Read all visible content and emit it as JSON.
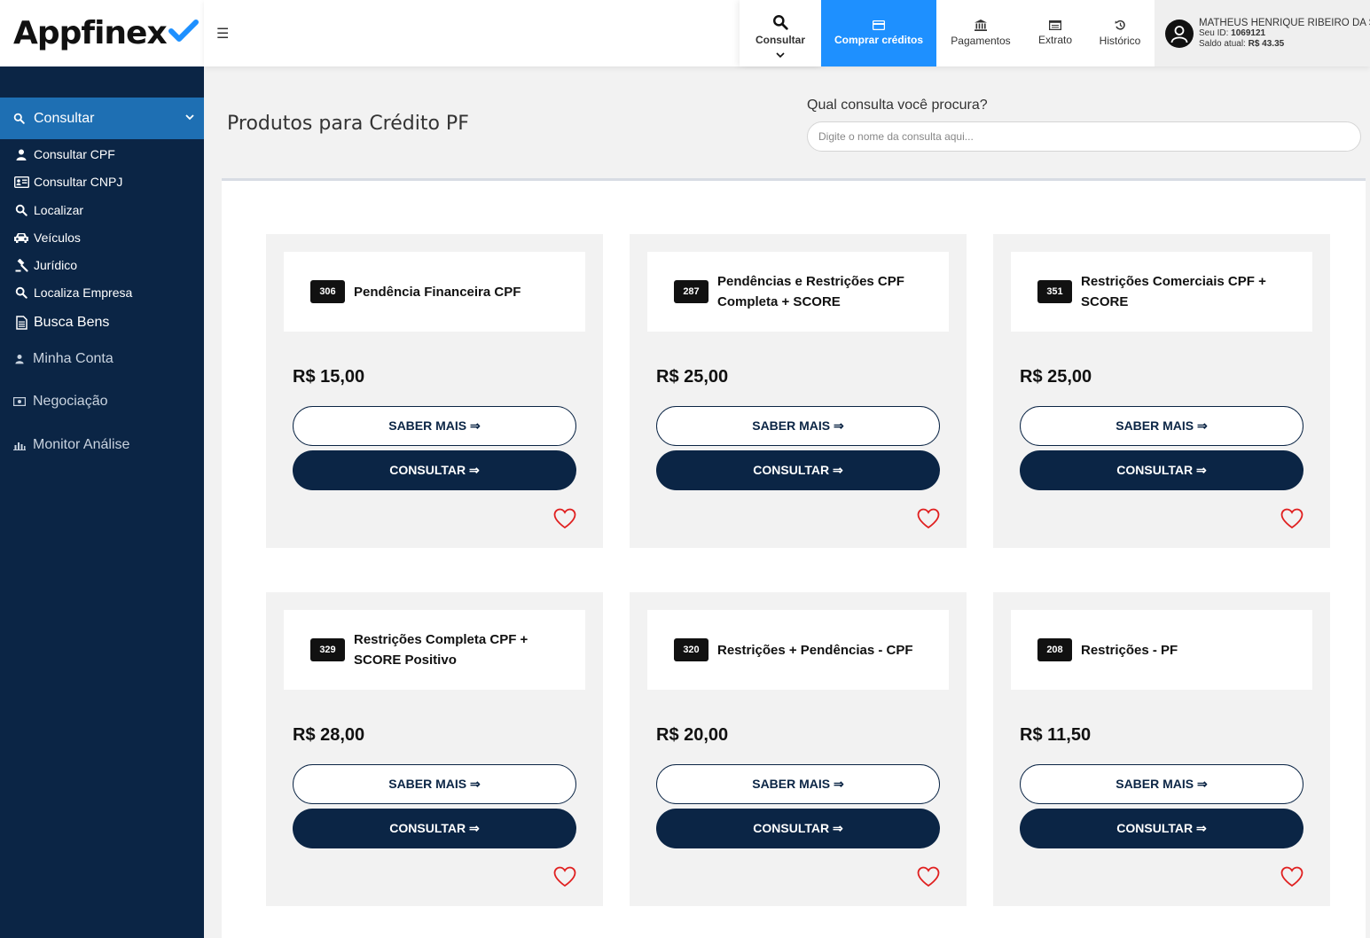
{
  "brand": {
    "name": "Appfinex"
  },
  "sidebar": {
    "active": {
      "label": "Consultar",
      "icon": "search-icon"
    },
    "subitems": [
      {
        "label": "Consultar CPF",
        "icon": "user-icon"
      },
      {
        "label": "Consultar CNPJ",
        "icon": "id-card-icon"
      },
      {
        "label": "Localizar",
        "icon": "search-icon"
      },
      {
        "label": "Veículos",
        "icon": "car-icon"
      },
      {
        "label": "Jurídico",
        "icon": "gavel-icon"
      },
      {
        "label": "Localiza Empresa",
        "icon": "search-icon"
      },
      {
        "label": "Busca Bens",
        "icon": "document-icon"
      }
    ],
    "items": [
      {
        "label": "Minha Conta",
        "icon": "user-icon"
      },
      {
        "label": "Negociação",
        "icon": "money-icon"
      },
      {
        "label": "Monitor Análise",
        "icon": "bar-chart-icon"
      }
    ]
  },
  "topbar": {
    "consultar": "Consultar",
    "comprar": "Comprar créditos",
    "pagamentos": "Pagamentos",
    "extrato": "Extrato",
    "historico": "Histórico"
  },
  "user": {
    "name": "MATHEUS HENRIQUE RIBEIRO DA S...",
    "id_label": "Seu ID:",
    "id": "1069121",
    "balance_label": "Saldo atual:",
    "balance": "R$ 43.35"
  },
  "page": {
    "title": "Produtos para Crédito PF",
    "search_label": "Qual consulta você procura?",
    "search_placeholder": "Digite o nome da consulta aqui..."
  },
  "products": [
    {
      "code": "306",
      "title": "Pendência Financeira CPF",
      "price": "R$ 15,00",
      "more": "SABER MAIS ⇒",
      "action": "CONSULTAR ⇒"
    },
    {
      "code": "287",
      "title": "Pendências e Restrições CPF Completa + SCORE",
      "price": "R$ 25,00",
      "more": "SABER MAIS ⇒",
      "action": "CONSULTAR ⇒"
    },
    {
      "code": "351",
      "title": "Restrições Comerciais CPF + SCORE",
      "price": "R$ 25,00",
      "more": "SABER MAIS ⇒",
      "action": "CONSULTAR ⇒"
    },
    {
      "code": "329",
      "title": "Restrições Completa CPF + SCORE Positivo",
      "price": "R$ 28,00",
      "more": "SABER MAIS ⇒",
      "action": "CONSULTAR ⇒"
    },
    {
      "code": "320",
      "title": "Restrições + Pendências - CPF",
      "price": "R$ 20,00",
      "more": "SABER MAIS ⇒",
      "action": "CONSULTAR ⇒"
    },
    {
      "code": "208",
      "title": "Restrições - PF",
      "price": "R$ 11,50",
      "more": "SABER MAIS ⇒",
      "action": "CONSULTAR ⇒"
    }
  ],
  "colors": {
    "sidebar": "#0b2545",
    "active": "#1e6fb3",
    "accent": "#1e90ff",
    "heart": "#e02020"
  }
}
